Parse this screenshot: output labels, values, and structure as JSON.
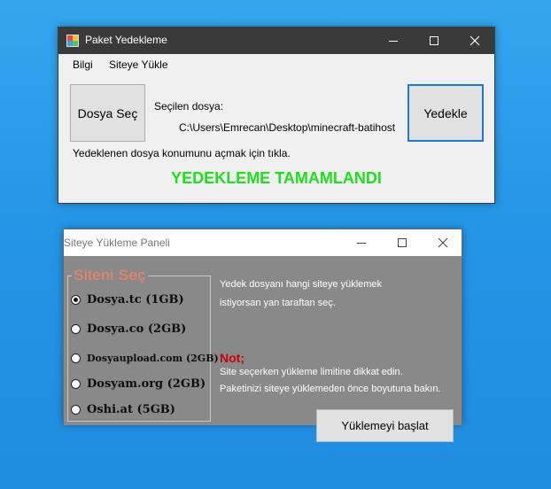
{
  "window1": {
    "title": "Paket Yedekleme",
    "menu": [
      "Bilgi",
      "Siteye Yükle"
    ],
    "select_button": "Dosya Seç",
    "selected_label": "Seçilen dosya:",
    "selected_path": "C:\\Users\\Emrecan\\Desktop\\minecraft-batihost",
    "backup_button": "Yedekle",
    "open_location_text": "Yedeklenen dosya konumunu açmak için tıkla.",
    "status": "YEDEKLEME TAMAMLANDI",
    "status_color": "#1fe01f"
  },
  "window2": {
    "title": "Siteye Yükleme Paneli",
    "group_label": "Siteni  Seç",
    "options": [
      {
        "label": "Dosya.tc (1GB)",
        "checked": true
      },
      {
        "label": "Dosya.co (2GB)",
        "checked": false
      },
      {
        "label": "Dosyaupload.com (2GB)",
        "checked": false
      },
      {
        "label": "Dosyam.org (2GB)",
        "checked": false
      },
      {
        "label": "Oshi.at (5GB)",
        "checked": false
      }
    ],
    "info_line1": "Yedek dosyanı hangi siteye yüklemek",
    "info_line2": "istiyorsan yan taraftan seç.",
    "note_title": "Not;",
    "note_line1": "Site seçerken yükleme limitine dikkat edin.",
    "note_line2": "Paketinizi siteye yüklemeden önce boyutuna bakın.",
    "start_button": "Yüklemeyi  başlat"
  }
}
